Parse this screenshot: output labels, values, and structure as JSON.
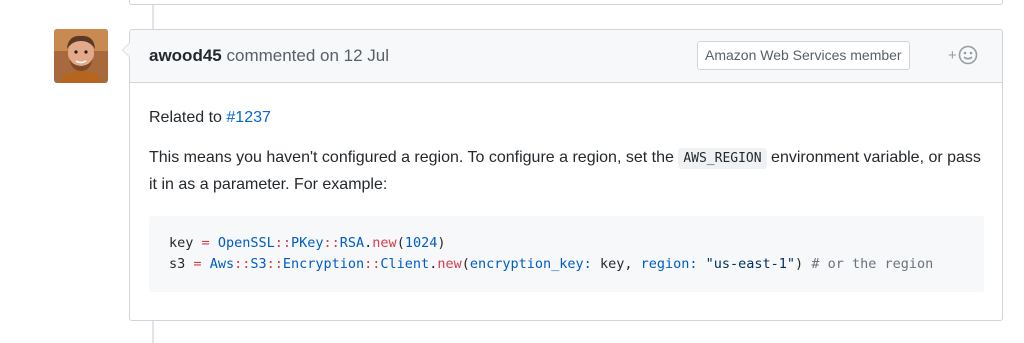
{
  "comment": {
    "author": "awood45",
    "meta_text": "commented on 12 Jul",
    "badge": "Amazon Web Services member",
    "reaction_plus": "+",
    "reaction_icon": "smiley-icon",
    "related_prefix": "Related to ",
    "issue_ref": "#1237",
    "para_before": "This means you haven't configured a region. To configure a region, set the ",
    "env_var": "AWS_REGION",
    "para_after": " environment variable, or pass it in as a parameter. For example:"
  },
  "code": {
    "line1": {
      "var": "key",
      "eq": "=",
      "c1": "OpenSSL",
      "sep1": "::",
      "c2": "PKey",
      "sep2": "::",
      "c3": "RSA",
      "dot": ".",
      "method": "new",
      "open": "(",
      "num": "1024",
      "close": ")"
    },
    "line2": {
      "var": "s3",
      "eq": "=",
      "c1": "Aws",
      "sep1": "::",
      "c2": "S3",
      "sep2": "::",
      "c3": "Encryption",
      "sep3": "::",
      "c4": "Client",
      "dot": ".",
      "method": "new",
      "open": "(",
      "key1": "encryption_key:",
      "val1": "key,",
      "key2": "region:",
      "str": "\"us-east-1\"",
      "close": ")",
      "comment": "# or the region"
    }
  },
  "colors": {
    "link": "#0366d6",
    "header_bg": "#f6f8fa",
    "border": "#d1d5da"
  }
}
